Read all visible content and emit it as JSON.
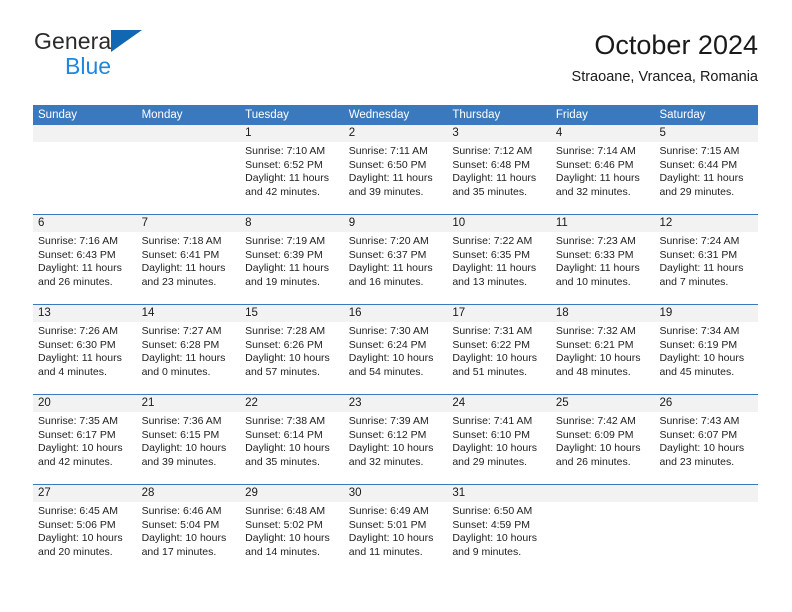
{
  "brand": {
    "line1": "General",
    "line2": "Blue",
    "triangle_color": "#1267b2",
    "line2_color": "#1f87dd"
  },
  "header": {
    "title": "October 2024",
    "subtitle": "Straoane, Vrancea, Romania"
  },
  "theme": {
    "header_blue": "#3b79bf",
    "daynum_band": "#f2f2f2",
    "text": "#222222"
  },
  "weekday_headers": [
    "Sunday",
    "Monday",
    "Tuesday",
    "Wednesday",
    "Thursday",
    "Friday",
    "Saturday"
  ],
  "labels": {
    "sunrise_prefix": "Sunrise:",
    "sunset_prefix": "Sunset:",
    "daylight_prefix": "Daylight:"
  },
  "weeks": [
    [
      {
        "day": "",
        "sunrise": "",
        "sunset": "",
        "daylight_l1": "",
        "daylight_l2": "",
        "blank": true
      },
      {
        "day": "",
        "sunrise": "",
        "sunset": "",
        "daylight_l1": "",
        "daylight_l2": "",
        "blank": true
      },
      {
        "day": "1",
        "sunrise": "Sunrise: 7:10 AM",
        "sunset": "Sunset: 6:52 PM",
        "daylight_l1": "Daylight: 11 hours",
        "daylight_l2": "and 42 minutes."
      },
      {
        "day": "2",
        "sunrise": "Sunrise: 7:11 AM",
        "sunset": "Sunset: 6:50 PM",
        "daylight_l1": "Daylight: 11 hours",
        "daylight_l2": "and 39 minutes."
      },
      {
        "day": "3",
        "sunrise": "Sunrise: 7:12 AM",
        "sunset": "Sunset: 6:48 PM",
        "daylight_l1": "Daylight: 11 hours",
        "daylight_l2": "and 35 minutes."
      },
      {
        "day": "4",
        "sunrise": "Sunrise: 7:14 AM",
        "sunset": "Sunset: 6:46 PM",
        "daylight_l1": "Daylight: 11 hours",
        "daylight_l2": "and 32 minutes."
      },
      {
        "day": "5",
        "sunrise": "Sunrise: 7:15 AM",
        "sunset": "Sunset: 6:44 PM",
        "daylight_l1": "Daylight: 11 hours",
        "daylight_l2": "and 29 minutes."
      }
    ],
    [
      {
        "day": "6",
        "sunrise": "Sunrise: 7:16 AM",
        "sunset": "Sunset: 6:43 PM",
        "daylight_l1": "Daylight: 11 hours",
        "daylight_l2": "and 26 minutes."
      },
      {
        "day": "7",
        "sunrise": "Sunrise: 7:18 AM",
        "sunset": "Sunset: 6:41 PM",
        "daylight_l1": "Daylight: 11 hours",
        "daylight_l2": "and 23 minutes."
      },
      {
        "day": "8",
        "sunrise": "Sunrise: 7:19 AM",
        "sunset": "Sunset: 6:39 PM",
        "daylight_l1": "Daylight: 11 hours",
        "daylight_l2": "and 19 minutes."
      },
      {
        "day": "9",
        "sunrise": "Sunrise: 7:20 AM",
        "sunset": "Sunset: 6:37 PM",
        "daylight_l1": "Daylight: 11 hours",
        "daylight_l2": "and 16 minutes."
      },
      {
        "day": "10",
        "sunrise": "Sunrise: 7:22 AM",
        "sunset": "Sunset: 6:35 PM",
        "daylight_l1": "Daylight: 11 hours",
        "daylight_l2": "and 13 minutes."
      },
      {
        "day": "11",
        "sunrise": "Sunrise: 7:23 AM",
        "sunset": "Sunset: 6:33 PM",
        "daylight_l1": "Daylight: 11 hours",
        "daylight_l2": "and 10 minutes."
      },
      {
        "day": "12",
        "sunrise": "Sunrise: 7:24 AM",
        "sunset": "Sunset: 6:31 PM",
        "daylight_l1": "Daylight: 11 hours",
        "daylight_l2": "and 7 minutes."
      }
    ],
    [
      {
        "day": "13",
        "sunrise": "Sunrise: 7:26 AM",
        "sunset": "Sunset: 6:30 PM",
        "daylight_l1": "Daylight: 11 hours",
        "daylight_l2": "and 4 minutes."
      },
      {
        "day": "14",
        "sunrise": "Sunrise: 7:27 AM",
        "sunset": "Sunset: 6:28 PM",
        "daylight_l1": "Daylight: 11 hours",
        "daylight_l2": "and 0 minutes."
      },
      {
        "day": "15",
        "sunrise": "Sunrise: 7:28 AM",
        "sunset": "Sunset: 6:26 PM",
        "daylight_l1": "Daylight: 10 hours",
        "daylight_l2": "and 57 minutes."
      },
      {
        "day": "16",
        "sunrise": "Sunrise: 7:30 AM",
        "sunset": "Sunset: 6:24 PM",
        "daylight_l1": "Daylight: 10 hours",
        "daylight_l2": "and 54 minutes."
      },
      {
        "day": "17",
        "sunrise": "Sunrise: 7:31 AM",
        "sunset": "Sunset: 6:22 PM",
        "daylight_l1": "Daylight: 10 hours",
        "daylight_l2": "and 51 minutes."
      },
      {
        "day": "18",
        "sunrise": "Sunrise: 7:32 AM",
        "sunset": "Sunset: 6:21 PM",
        "daylight_l1": "Daylight: 10 hours",
        "daylight_l2": "and 48 minutes."
      },
      {
        "day": "19",
        "sunrise": "Sunrise: 7:34 AM",
        "sunset": "Sunset: 6:19 PM",
        "daylight_l1": "Daylight: 10 hours",
        "daylight_l2": "and 45 minutes."
      }
    ],
    [
      {
        "day": "20",
        "sunrise": "Sunrise: 7:35 AM",
        "sunset": "Sunset: 6:17 PM",
        "daylight_l1": "Daylight: 10 hours",
        "daylight_l2": "and 42 minutes."
      },
      {
        "day": "21",
        "sunrise": "Sunrise: 7:36 AM",
        "sunset": "Sunset: 6:15 PM",
        "daylight_l1": "Daylight: 10 hours",
        "daylight_l2": "and 39 minutes."
      },
      {
        "day": "22",
        "sunrise": "Sunrise: 7:38 AM",
        "sunset": "Sunset: 6:14 PM",
        "daylight_l1": "Daylight: 10 hours",
        "daylight_l2": "and 35 minutes."
      },
      {
        "day": "23",
        "sunrise": "Sunrise: 7:39 AM",
        "sunset": "Sunset: 6:12 PM",
        "daylight_l1": "Daylight: 10 hours",
        "daylight_l2": "and 32 minutes."
      },
      {
        "day": "24",
        "sunrise": "Sunrise: 7:41 AM",
        "sunset": "Sunset: 6:10 PM",
        "daylight_l1": "Daylight: 10 hours",
        "daylight_l2": "and 29 minutes."
      },
      {
        "day": "25",
        "sunrise": "Sunrise: 7:42 AM",
        "sunset": "Sunset: 6:09 PM",
        "daylight_l1": "Daylight: 10 hours",
        "daylight_l2": "and 26 minutes."
      },
      {
        "day": "26",
        "sunrise": "Sunrise: 7:43 AM",
        "sunset": "Sunset: 6:07 PM",
        "daylight_l1": "Daylight: 10 hours",
        "daylight_l2": "and 23 minutes."
      }
    ],
    [
      {
        "day": "27",
        "sunrise": "Sunrise: 6:45 AM",
        "sunset": "Sunset: 5:06 PM",
        "daylight_l1": "Daylight: 10 hours",
        "daylight_l2": "and 20 minutes."
      },
      {
        "day": "28",
        "sunrise": "Sunrise: 6:46 AM",
        "sunset": "Sunset: 5:04 PM",
        "daylight_l1": "Daylight: 10 hours",
        "daylight_l2": "and 17 minutes."
      },
      {
        "day": "29",
        "sunrise": "Sunrise: 6:48 AM",
        "sunset": "Sunset: 5:02 PM",
        "daylight_l1": "Daylight: 10 hours",
        "daylight_l2": "and 14 minutes."
      },
      {
        "day": "30",
        "sunrise": "Sunrise: 6:49 AM",
        "sunset": "Sunset: 5:01 PM",
        "daylight_l1": "Daylight: 10 hours",
        "daylight_l2": "and 11 minutes."
      },
      {
        "day": "31",
        "sunrise": "Sunrise: 6:50 AM",
        "sunset": "Sunset: 4:59 PM",
        "daylight_l1": "Daylight: 10 hours",
        "daylight_l2": "and 9 minutes."
      },
      {
        "day": "",
        "sunrise": "",
        "sunset": "",
        "daylight_l1": "",
        "daylight_l2": "",
        "blank": true
      },
      {
        "day": "",
        "sunrise": "",
        "sunset": "",
        "daylight_l1": "",
        "daylight_l2": "",
        "blank": true
      }
    ]
  ]
}
